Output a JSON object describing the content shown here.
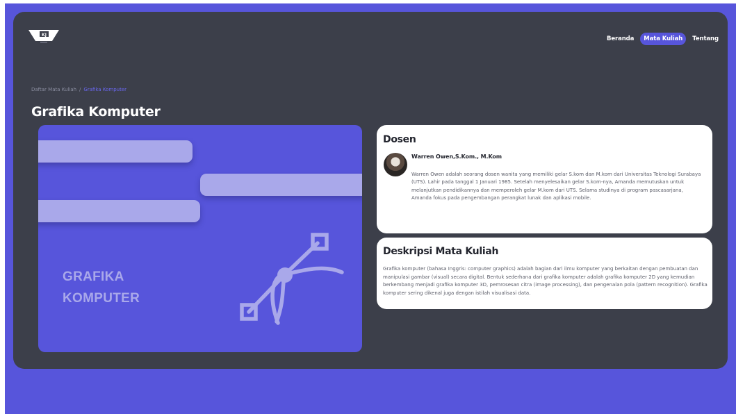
{
  "header": {
    "logo_text": "KJ",
    "nav": [
      {
        "label": "Beranda",
        "active": false
      },
      {
        "label": "Mata Kuliah",
        "active": true
      },
      {
        "label": "Tentang",
        "active": false
      }
    ]
  },
  "breadcrumb": {
    "parent": "Daftar Mata Kuliah",
    "separator": "/",
    "current": "Grafika Komputer"
  },
  "page_title": "Grafika Komputer",
  "banner": {
    "line1": "GRAFIKA",
    "line2": "KOMPUTER",
    "icon": "bezier-curve-icon"
  },
  "lecturer": {
    "heading": "Dosen",
    "name": "Warren Owen,S.Kom., M.Kom",
    "bio": "Warren Owen adalah seorang dosen wanita yang memiliki gelar S.kom dan M.kom dari Universitas Teknologi Surabaya (UTS). Lahir pada tanggal 1 Januari 1985. Setelah menyelesaikan gelar S.kom-nya, Amanda memutuskan untuk melanjutkan pendidikannya dan memperoleh gelar M.kom dari UTS. Selama studinya di program pascasarjana, Amanda fokus pada pengembangan perangkat lunak dan aplikasi mobile."
  },
  "course": {
    "heading": "Deskripsi Mata Kuliah",
    "description": "Grafika komputer (bahasa Inggris: computer graphics) adalah bagian dari ilmu komputer yang berkaitan dengan pembuatan dan manipulasi gambar (visual) secara digital. Bentuk sederhana dari grafika komputer adalah grafika komputer 2D yang kemudian berkembang menjadi grafika komputer 3D, pemrosesan citra (image processing), dan pengenalan pola (pattern recognition). Grafika komputer sering dikenal juga dengan istilah visualisasi data."
  },
  "colors": {
    "accent": "#5755db",
    "card_bg": "#3c3f4a",
    "banner_shape": "#a9a8ea",
    "panel_bg": "#ffffff"
  }
}
